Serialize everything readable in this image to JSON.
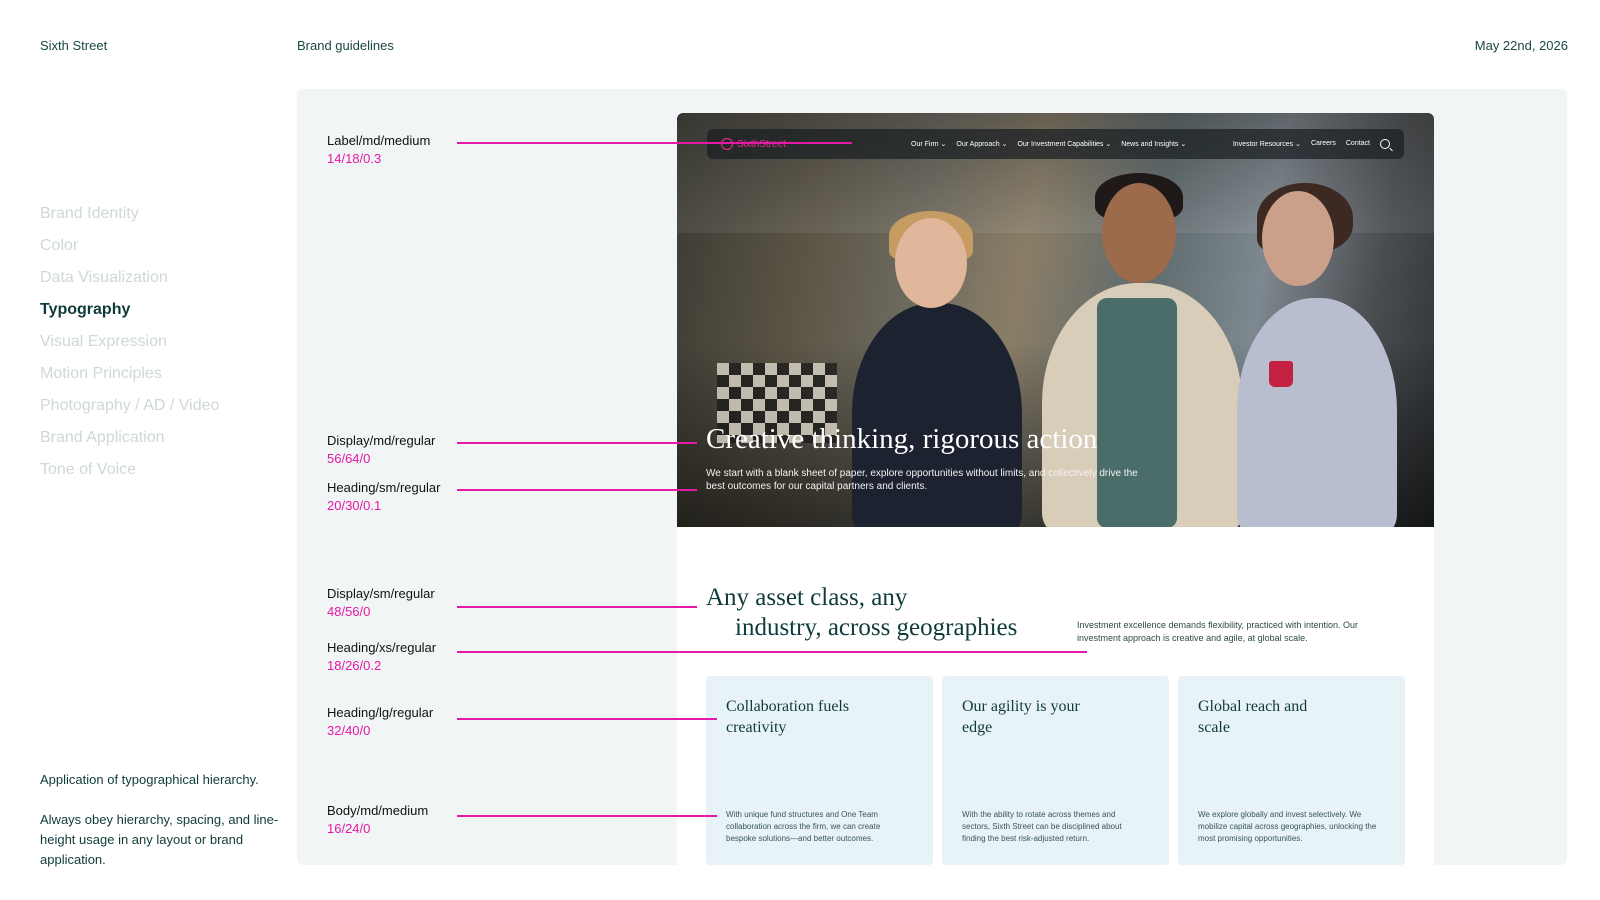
{
  "header": {
    "brand": "Sixth Street",
    "doc_title": "Brand guidelines",
    "date": "May 22nd, 2026"
  },
  "sidebar": {
    "items": [
      {
        "label": "Brand Identity",
        "active": false
      },
      {
        "label": "Color",
        "active": false
      },
      {
        "label": "Data Visualization",
        "active": false
      },
      {
        "label": "Typography",
        "active": true
      },
      {
        "label": "Visual Expression",
        "active": false
      },
      {
        "label": "Motion Principles",
        "active": false
      },
      {
        "label": "Photography / AD / Video",
        "active": false
      },
      {
        "label": "Brand Application",
        "active": false
      },
      {
        "label": "Tone of Voice",
        "active": false
      }
    ]
  },
  "notes": {
    "caption": "Application of typographical hierarchy.",
    "guidance": "Always obey hierarchy, spacing, and line-height usage in any layout or brand application."
  },
  "specs": [
    {
      "name": "Label/md/medium",
      "value": "14/18/0.3"
    },
    {
      "name": "Display/md/regular",
      "value": "56/64/0"
    },
    {
      "name": "Heading/sm/regular",
      "value": "20/30/0.1"
    },
    {
      "name": "Display/sm/regular",
      "value": "48/56/0"
    },
    {
      "name": "Heading/xs/regular",
      "value": "18/26/0.2"
    },
    {
      "name": "Heading/lg/regular",
      "value": "32/40/0"
    },
    {
      "name": "Body/md/medium",
      "value": "16/24/0"
    }
  ],
  "mockup": {
    "logo_text": "SixthStreet",
    "nav_left": [
      "Our Firm ⌄",
      "Our Approach ⌄",
      "Our Investment Capabilities ⌄",
      "News and Insights ⌄"
    ],
    "nav_right": [
      "Investor Resources ⌄",
      "Careers",
      "Contact"
    ],
    "hero_title": "Creative thinking, rigorous action",
    "hero_body": "We start with a blank sheet of paper, explore opportunities without limits, and collectively drive the best outcomes for our capital partners and clients.",
    "section_title_line1": "Any asset class, any",
    "section_title_line2": "industry, across geographies",
    "section_body": "Investment excellence demands flexibility, practiced with intention. Our investment approach is creative and agile, at global scale.",
    "cards": [
      {
        "title": "Collaboration fuels creativity",
        "body": "With unique fund structures and One Team collaboration across the firm, we can create bespoke solutions—and better outcomes."
      },
      {
        "title": "Our agility is your edge",
        "body": "With the ability to rotate across themes and sectors, Sixth Street can be disciplined about finding the best risk-adjusted return."
      },
      {
        "title": "Global reach and scale",
        "body": "We explore globally and invest selectively. We mobilize capital across geographies, unlocking the most promising opportunities."
      }
    ]
  },
  "colors": {
    "accent_magenta": "#e41aa6",
    "brand_pink": "#ef2f8b",
    "ink": "#0f3b3a",
    "panel": "#f2f5f6",
    "card": "#e7f3f6"
  }
}
